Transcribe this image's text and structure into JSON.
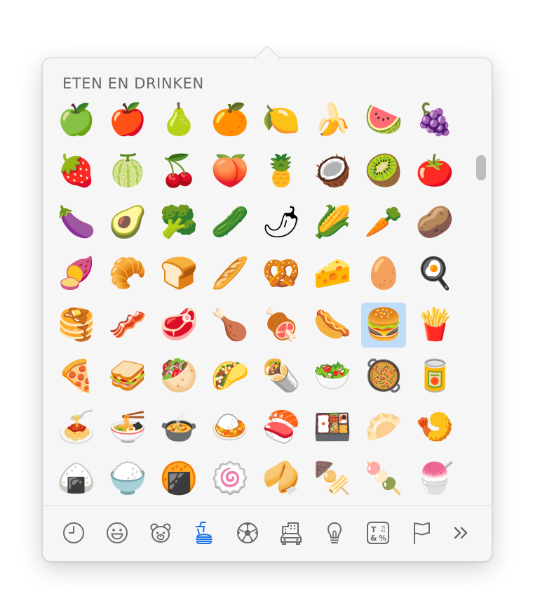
{
  "picker": {
    "category_title": "ETEN EN DRINKEN",
    "active_tab": "food-and-drink",
    "selected_emoji": "🍔",
    "emojis": [
      {
        "char": "🍏",
        "name": "emoji-green-apple"
      },
      {
        "char": "🍎",
        "name": "emoji-red-apple"
      },
      {
        "char": "🍐",
        "name": "emoji-pear"
      },
      {
        "char": "🍊",
        "name": "emoji-tangerine"
      },
      {
        "char": "🍋",
        "name": "emoji-lemon"
      },
      {
        "char": "🍌",
        "name": "emoji-banana"
      },
      {
        "char": "🍉",
        "name": "emoji-watermelon"
      },
      {
        "char": "🍇",
        "name": "emoji-grapes"
      },
      {
        "char": "🍓",
        "name": "emoji-strawberry"
      },
      {
        "char": "🍈",
        "name": "emoji-melon"
      },
      {
        "char": "🍒",
        "name": "emoji-cherries"
      },
      {
        "char": "🍑",
        "name": "emoji-peach"
      },
      {
        "char": "🍍",
        "name": "emoji-pineapple"
      },
      {
        "char": "🥥",
        "name": "emoji-coconut"
      },
      {
        "char": "🥝",
        "name": "emoji-kiwi"
      },
      {
        "char": "🍅",
        "name": "emoji-tomato"
      },
      {
        "char": "🍆",
        "name": "emoji-eggplant"
      },
      {
        "char": "🥑",
        "name": "emoji-avocado"
      },
      {
        "char": "🥦",
        "name": "emoji-broccoli"
      },
      {
        "char": "🥒",
        "name": "emoji-cucumber"
      },
      {
        "char": "🌶",
        "name": "emoji-hot-pepper"
      },
      {
        "char": "🌽",
        "name": "emoji-corn"
      },
      {
        "char": "🥕",
        "name": "emoji-carrot"
      },
      {
        "char": "🥔",
        "name": "emoji-potato"
      },
      {
        "char": "🍠",
        "name": "emoji-sweet-potato"
      },
      {
        "char": "🥐",
        "name": "emoji-croissant"
      },
      {
        "char": "🍞",
        "name": "emoji-bread"
      },
      {
        "char": "🥖",
        "name": "emoji-baguette"
      },
      {
        "char": "🥨",
        "name": "emoji-pretzel"
      },
      {
        "char": "🧀",
        "name": "emoji-cheese"
      },
      {
        "char": "🥚",
        "name": "emoji-egg"
      },
      {
        "char": "🍳",
        "name": "emoji-cooking"
      },
      {
        "char": "🥞",
        "name": "emoji-pancakes"
      },
      {
        "char": "🥓",
        "name": "emoji-bacon"
      },
      {
        "char": "🥩",
        "name": "emoji-cut-of-meat"
      },
      {
        "char": "🍗",
        "name": "emoji-poultry-leg"
      },
      {
        "char": "🍖",
        "name": "emoji-meat-on-bone"
      },
      {
        "char": "🌭",
        "name": "emoji-hot-dog"
      },
      {
        "char": "🍔",
        "name": "emoji-hamburger"
      },
      {
        "char": "🍟",
        "name": "emoji-french-fries"
      },
      {
        "char": "🍕",
        "name": "emoji-pizza"
      },
      {
        "char": "🥪",
        "name": "emoji-sandwich"
      },
      {
        "char": "🥙",
        "name": "emoji-stuffed-flatbread"
      },
      {
        "char": "🌮",
        "name": "emoji-taco"
      },
      {
        "char": "🌯",
        "name": "emoji-burrito"
      },
      {
        "char": "🥗",
        "name": "emoji-green-salad"
      },
      {
        "char": "🥘",
        "name": "emoji-shallow-pan-of-food"
      },
      {
        "char": "🥫",
        "name": "emoji-canned-food"
      },
      {
        "char": "🍝",
        "name": "emoji-spaghetti"
      },
      {
        "char": "🍜",
        "name": "emoji-steaming-bowl"
      },
      {
        "char": "🍲",
        "name": "emoji-pot-of-food"
      },
      {
        "char": "🍛",
        "name": "emoji-curry-rice"
      },
      {
        "char": "🍣",
        "name": "emoji-sushi"
      },
      {
        "char": "🍱",
        "name": "emoji-bento-box"
      },
      {
        "char": "🥟",
        "name": "emoji-dumpling"
      },
      {
        "char": "🍤",
        "name": "emoji-fried-shrimp"
      },
      {
        "char": "🍙",
        "name": "emoji-rice-ball"
      },
      {
        "char": "🍚",
        "name": "emoji-cooked-rice"
      },
      {
        "char": "🍘",
        "name": "emoji-rice-cracker"
      },
      {
        "char": "🍥",
        "name": "emoji-fish-cake"
      },
      {
        "char": "🥠",
        "name": "emoji-fortune-cookie"
      },
      {
        "char": "🍢",
        "name": "emoji-oden"
      },
      {
        "char": "🍡",
        "name": "emoji-dango"
      },
      {
        "char": "🍧",
        "name": "emoji-shaved-ice"
      }
    ],
    "tabs": [
      {
        "name": "tab-recent",
        "icon": "clock-icon"
      },
      {
        "name": "tab-smileys",
        "icon": "smiley-icon"
      },
      {
        "name": "tab-animals",
        "icon": "bear-icon"
      },
      {
        "name": "tab-food-and-drink",
        "icon": "burger-drink-icon",
        "active": true
      },
      {
        "name": "tab-activity",
        "icon": "soccer-ball-icon"
      },
      {
        "name": "tab-travel",
        "icon": "buildings-car-icon"
      },
      {
        "name": "tab-objects",
        "icon": "lightbulb-icon"
      },
      {
        "name": "tab-symbols",
        "icon": "symbols-icon"
      },
      {
        "name": "tab-flags",
        "icon": "flag-icon"
      },
      {
        "name": "tab-more",
        "icon": "double-chevron-right-icon"
      }
    ],
    "colors": {
      "accent": "#1a73e8",
      "icon_gray": "#6b6b6b",
      "selection": "#bfdcfb"
    }
  }
}
